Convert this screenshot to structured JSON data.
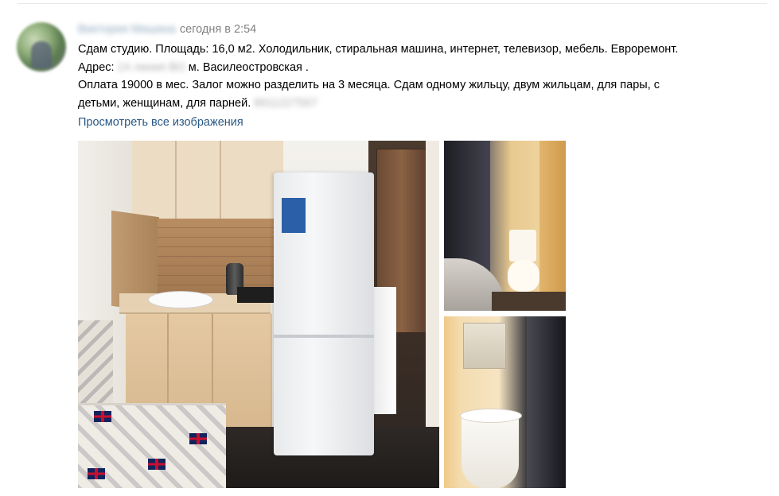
{
  "post": {
    "author_name": "Виктория Мишина",
    "date": "сегодня в 2:54",
    "text_line_1": "Сдам студию. Площадь: 16,0 м2. Холодильник, стиральная машина, интернет, телевизор, мебель. Евроремонт.",
    "address_label": "Адрес:",
    "address_hidden": "14 линия ВО",
    "address_metro": "м. Василеостровская .",
    "text_line_3": "Оплата 19000 в мес. Залог можно разделить на 3 месяца. Сдам одному жильцу, двум жильцам, для пары, с",
    "text_line_4": "детьми, женщинам, для парней.",
    "phone_hidden": "8911227567",
    "show_all_images": "Просмотреть все изображения"
  },
  "colors": {
    "link": "#2a5885",
    "meta": "#828282",
    "divider": "#e7e8ec"
  },
  "photos": [
    {
      "name": "photo-kitchenette",
      "subject": "kitchenette with fridge"
    },
    {
      "name": "photo-toilet",
      "subject": "bathroom toilet and shower"
    },
    {
      "name": "photo-sink",
      "subject": "bathroom sink and shower"
    }
  ]
}
